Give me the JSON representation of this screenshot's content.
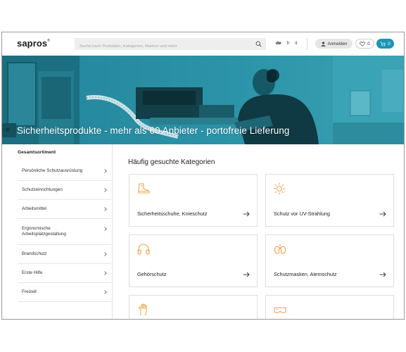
{
  "header": {
    "logo": "sapros",
    "logo_mark": "®",
    "search_placeholder": "Suche nach Produkten, Kategorien, Marken und mehr",
    "languages": [
      "de",
      "fr",
      "it"
    ],
    "active_language": "de",
    "login_label": "Anmelden",
    "wishlist_count": "0",
    "cart_count": "0"
  },
  "hero": {
    "title": "Sicherheitsprodukte - mehr als 60 Anbieter - portofreie Lieferung"
  },
  "sidebar": {
    "title": "Gesamtsortiment",
    "items": [
      {
        "label": "Persönliche Schutzausrüstung"
      },
      {
        "label": "Schutzeinrichtungen"
      },
      {
        "label": "Arbeitsmittel"
      },
      {
        "label": "Ergonomische Arbeitsplatzgestaltung"
      },
      {
        "label": "Brandschutz"
      },
      {
        "label": "Erste Hilfe"
      },
      {
        "label": "Freizeit"
      }
    ]
  },
  "main": {
    "title": "Häufig gesuchte Kategorien",
    "cards": [
      {
        "label": "Sicherheitsschuhe, Knieschutz",
        "icon": "boot-icon"
      },
      {
        "label": "Schutz vor UV-Strahlung",
        "icon": "sun-icon"
      },
      {
        "label": "Gehörschutz",
        "icon": "headphones-icon"
      },
      {
        "label": "Schutzmasken, Atemschutz",
        "icon": "lungs-icon"
      },
      {
        "label": "",
        "icon": "glove-icon"
      },
      {
        "label": "",
        "icon": "goggles-icon"
      }
    ]
  },
  "colors": {
    "accent": "#1a95b4",
    "icon_orange": "#f0a143",
    "hero_teal": "#1f7f91"
  }
}
